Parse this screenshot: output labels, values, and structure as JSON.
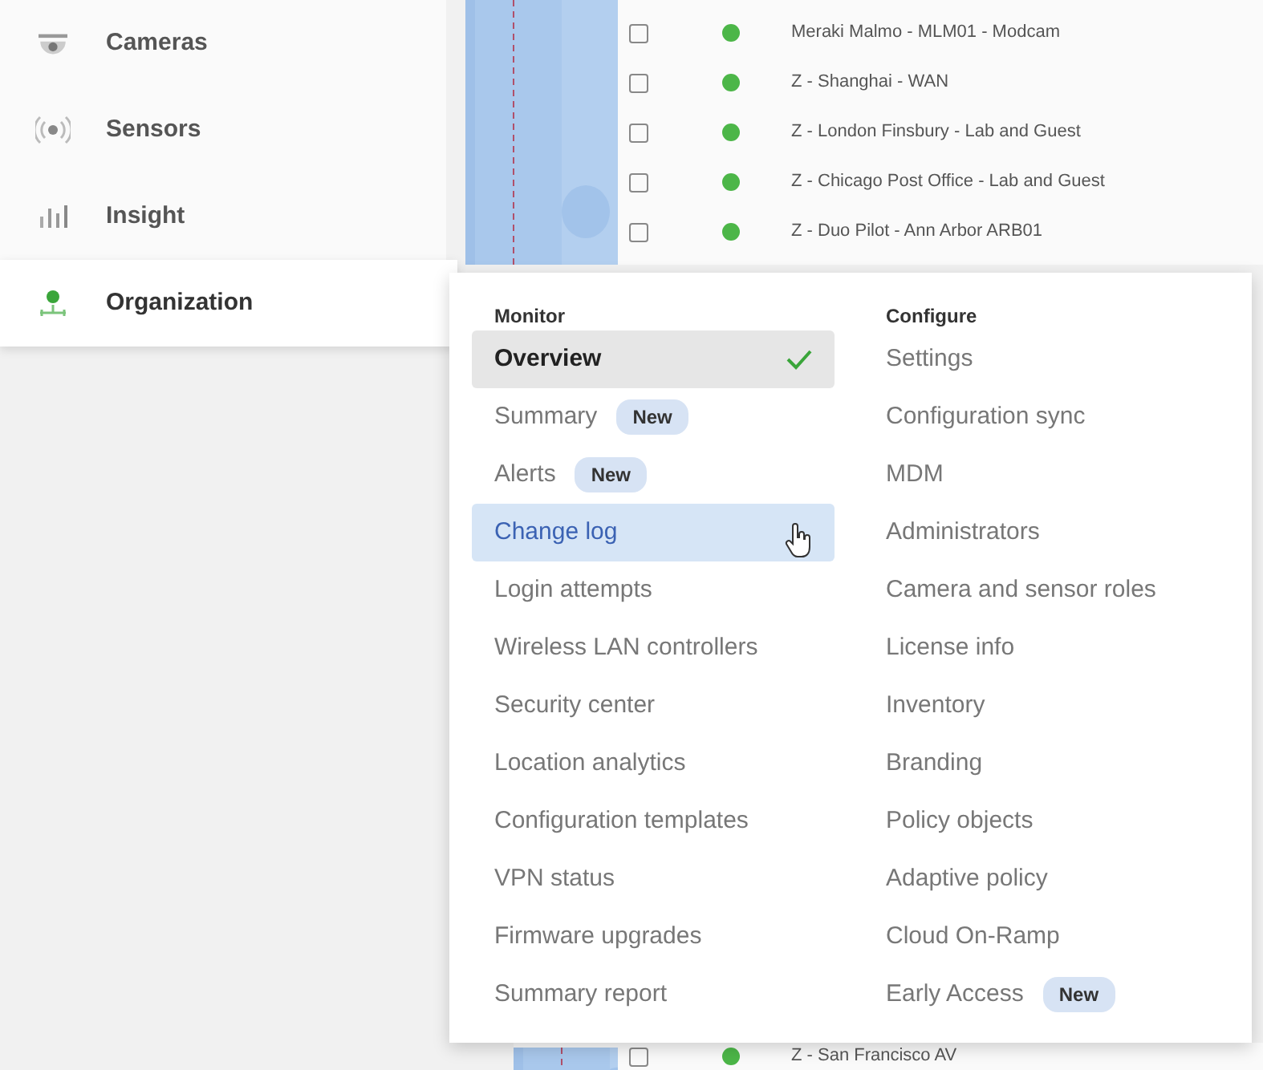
{
  "sidebar": {
    "items": [
      {
        "label": "Cameras",
        "kind": "camera",
        "selected": false
      },
      {
        "label": "Sensors",
        "kind": "sensor",
        "selected": false
      },
      {
        "label": "Insight",
        "kind": "insight",
        "selected": false
      },
      {
        "label": "Organization",
        "kind": "organization",
        "selected": true
      }
    ]
  },
  "networks": {
    "top_rows": [
      {
        "name": "Meraki Malmo - MLM01 - Modcam",
        "checked": false,
        "color": "#4cb648"
      },
      {
        "name": "Z - Shanghai - WAN",
        "checked": false,
        "color": "#4cb648"
      },
      {
        "name": "Z - London Finsbury - Lab and Guest",
        "checked": false,
        "color": "#4cb648"
      },
      {
        "name": "Z - Chicago Post Office - Lab and Guest",
        "checked": false,
        "color": "#4cb648"
      },
      {
        "name": "Z - Duo Pilot - Ann Arbor ARB01",
        "checked": false,
        "color": "#4cb648"
      }
    ],
    "bottom_rows": [
      {
        "name": "Z - San Francisco AV",
        "checked": false,
        "color": "#4cb648"
      }
    ]
  },
  "menu": {
    "columns": [
      {
        "heading": "Monitor",
        "items": [
          {
            "label": "Overview",
            "selected": true,
            "hovered": false
          },
          {
            "label": "Summary",
            "selected": false,
            "hovered": false,
            "badge": "New"
          },
          {
            "label": "Alerts",
            "selected": false,
            "hovered": false,
            "badge": "New"
          },
          {
            "label": "Change log",
            "selected": false,
            "hovered": true
          },
          {
            "label": "Login attempts",
            "selected": false,
            "hovered": false
          },
          {
            "label": "Wireless LAN controllers",
            "selected": false,
            "hovered": false
          },
          {
            "label": "Security center",
            "selected": false,
            "hovered": false
          },
          {
            "label": "Location analytics",
            "selected": false,
            "hovered": false
          },
          {
            "label": "Configuration templates",
            "selected": false,
            "hovered": false
          },
          {
            "label": "VPN status",
            "selected": false,
            "hovered": false
          },
          {
            "label": "Firmware upgrades",
            "selected": false,
            "hovered": false
          },
          {
            "label": "Summary report",
            "selected": false,
            "hovered": false
          }
        ]
      },
      {
        "heading": "Configure",
        "items": [
          {
            "label": "Settings",
            "selected": false,
            "hovered": false
          },
          {
            "label": "Configuration sync",
            "selected": false,
            "hovered": false
          },
          {
            "label": "MDM",
            "selected": false,
            "hovered": false
          },
          {
            "label": "Administrators",
            "selected": false,
            "hovered": false
          },
          {
            "label": "Camera and sensor roles",
            "selected": false,
            "hovered": false
          },
          {
            "label": "License info",
            "selected": false,
            "hovered": false
          },
          {
            "label": "Inventory",
            "selected": false,
            "hovered": false
          },
          {
            "label": "Branding",
            "selected": false,
            "hovered": false
          },
          {
            "label": "Policy objects",
            "selected": false,
            "hovered": false
          },
          {
            "label": "Adaptive policy",
            "selected": false,
            "hovered": false
          },
          {
            "label": "Cloud On-Ramp",
            "selected": false,
            "hovered": false
          },
          {
            "label": "Early Access",
            "selected": false,
            "hovered": false,
            "badge": "New"
          }
        ]
      }
    ]
  }
}
